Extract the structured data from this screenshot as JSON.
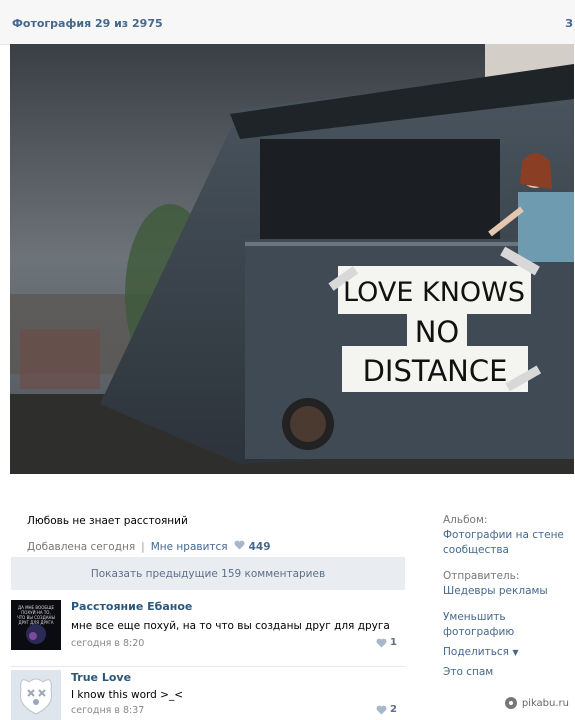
{
  "header": {
    "title": "Фотография 29 из 2975",
    "nav_right": "З"
  },
  "photo": {
    "sign_lines": [
      "LOVE KNOWS",
      "NO",
      "DISTANCE"
    ]
  },
  "caption": "Любовь не знает расстояний",
  "meta": {
    "added": "Добавлена сегодня",
    "separator": "|",
    "like_label": "Мне нравится",
    "like_count": "449"
  },
  "show_previous": "Показать предыдущие 159 комментариев",
  "comments": [
    {
      "author": "Расстояние Ебаное",
      "text": "мне все еще похуй, на то что вы созданы друг для друга",
      "time": "сегодня в 8:20",
      "likes": "1",
      "avatar_text": "ДА МНЕ ВООБЩЕ ПОХУЙ НА ТО, ЧТО ВЫ СОЗДАНЫ ДРУГ ДЛЯ ДРУГА"
    },
    {
      "author": "True Love",
      "text": "I know this word >_<",
      "time": "сегодня в 8:37",
      "likes": "2"
    }
  ],
  "sidebar": {
    "album_label": "Альбом:",
    "album_value": "Фотографии на стене сообщества",
    "sender_label": "Отправитель:",
    "sender_value": "Шедевры рекламы",
    "action_shrink": "Уменьшить фотографию",
    "action_share": "Поделиться",
    "action_spam": "Это спам"
  },
  "watermark": "pikabu.ru",
  "colors": {
    "link": "#45688e",
    "bar": "#e9edf1"
  }
}
